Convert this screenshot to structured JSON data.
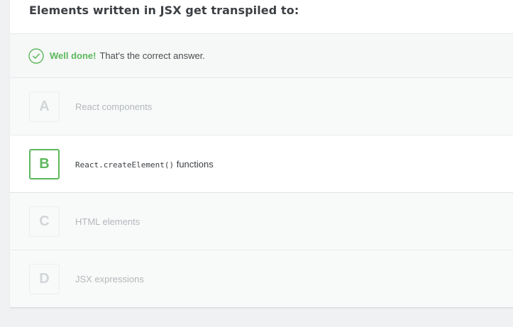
{
  "question": {
    "text": "Elements written in JSX get transpiled to:"
  },
  "feedback": {
    "icon": "check-circle-icon",
    "strong": "Well done!",
    "text": "That's the correct answer.",
    "color": "#5cb85c"
  },
  "options": [
    {
      "letter": "A",
      "text": "React components",
      "selected": false
    },
    {
      "letter": "B",
      "code": "React.createElement()",
      "text": "functions",
      "selected": true
    },
    {
      "letter": "C",
      "text": "HTML elements",
      "selected": false
    },
    {
      "letter": "D",
      "text": "JSX expressions",
      "selected": false
    }
  ]
}
